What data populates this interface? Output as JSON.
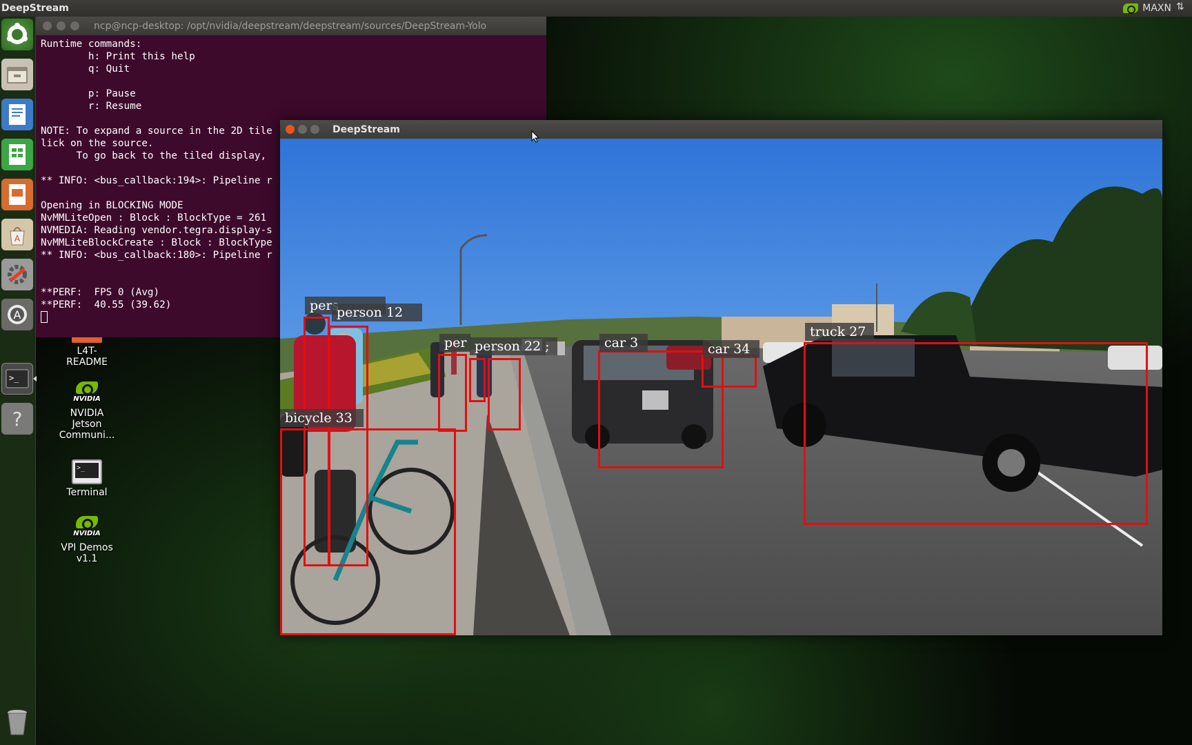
{
  "top_panel": {
    "app_title": "DeepStream",
    "power_mode": "MAXN"
  },
  "launcher": {
    "items": [
      "ubuntu-dash",
      "files",
      "writer",
      "calc",
      "impress",
      "software-center",
      "system-settings",
      "software-updater",
      "terminal",
      "help"
    ],
    "trash": "trash"
  },
  "desktop": {
    "icons": [
      {
        "label": "L4T-\nREADME"
      },
      {
        "label": "NVIDIA\nJetson\nCommuni..."
      },
      {
        "label": "Terminal"
      },
      {
        "label": "VPI Demos\nv1.1"
      }
    ],
    "nvidia_word": "NVIDIA"
  },
  "terminal": {
    "title": "ncp@ncp-desktop: /opt/nvidia/deepstream/deepstream/sources/DeepStream-Yolo",
    "lines": [
      "Runtime commands:",
      "        h: Print this help",
      "        q: Quit",
      "",
      "        p: Pause",
      "        r: Resume",
      "",
      "NOTE: To expand a source in the 2D tile",
      "lick on the source.",
      "      To go back to the tiled display,",
      "",
      "** INFO: <bus_callback:194>: Pipeline r",
      "",
      "Opening in BLOCKING MODE",
      "NvMMLiteOpen : Block : BlockType = 261",
      "NVMEDIA: Reading vendor.tegra.display-s",
      "NvMMLiteBlockCreate : Block : BlockType",
      "** INFO: <bus_callback:180>: Pipeline r",
      "",
      "",
      "**PERF:  FPS 0 (Avg)",
      "**PERF:  40.55 (39.62)"
    ]
  },
  "deepstream": {
    "title": "DeepStream",
    "detections": [
      {
        "label": "person 25",
        "shown": "pers"
      },
      {
        "label": "person 12",
        "shown": "person 12"
      },
      {
        "label": "bicycle 33",
        "shown": "bicycle 33"
      },
      {
        "label": "person",
        "shown": "per"
      },
      {
        "label": "person 22",
        "shown": "person 22 ;"
      },
      {
        "label": "car 3",
        "shown": "car 3"
      },
      {
        "label": "car 34",
        "shown": "car 34"
      },
      {
        "label": "truck 27",
        "shown": "truck 27"
      }
    ]
  },
  "colors": {
    "bbox": "#e30f0f",
    "terminal_bg": "#3d0a2c",
    "nvidia_green": "#76b900"
  }
}
